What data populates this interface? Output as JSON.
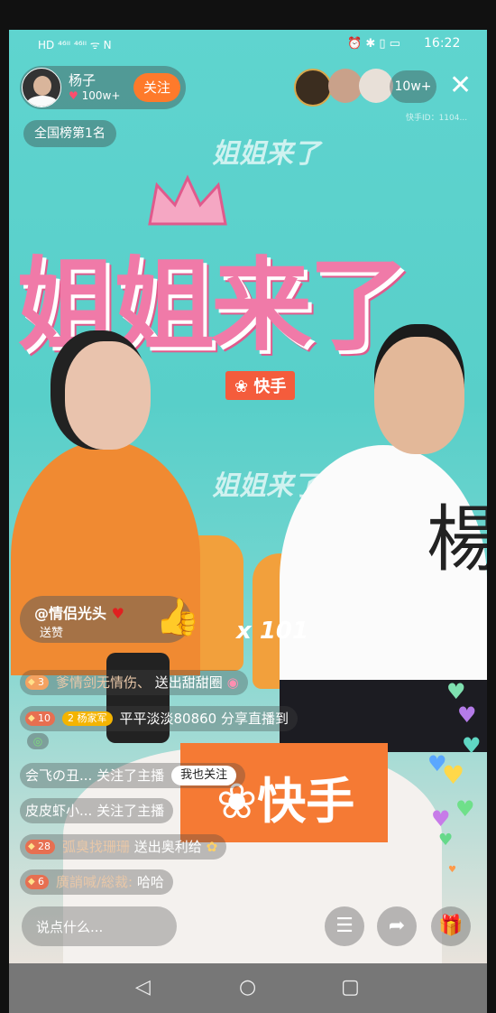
{
  "status_bar": {
    "left": "HD ⁴⁶ᴵᴵ ⁴⁶ᴵᴵ ᯤ N",
    "time": "16:22"
  },
  "host": {
    "name": "杨子",
    "likes": "100w+",
    "follow_label": "关注"
  },
  "rank_badge": "全国榜第1名",
  "viewer_count": "10w+",
  "stream_id": "快手ID：1104...",
  "backdrop": {
    "title": "姐姐来了",
    "brand": "快手"
  },
  "gift": {
    "user": "@情侣光头",
    "action": "送赞",
    "combo": "x 101"
  },
  "comments": [
    {
      "level": "3",
      "user": "爹情剑无情伤、",
      "text": "送出甜甜圈",
      "lvl_color": "#f4a261"
    },
    {
      "level": "10",
      "badge": "2 杨家军",
      "user": "平平淡淡80860",
      "text": "分享直播到",
      "lvl_color": "#e76f51"
    },
    {
      "user": "会飞の丑...",
      "text": "关注了主播",
      "extra_button": "我也关注"
    },
    {
      "user": "皮皮虾小...",
      "text": "关注了主播"
    },
    {
      "level": "28",
      "user": "弧臭找珊珊",
      "text": "送出奥利给",
      "lvl_color": "#e76f51"
    },
    {
      "level": "6",
      "user": "廣誚喊/総裁:",
      "text": "哈哈",
      "lvl_color": "#e76f51"
    }
  ],
  "input": {
    "placeholder": "说点什么..."
  },
  "shirt_text": "楊"
}
